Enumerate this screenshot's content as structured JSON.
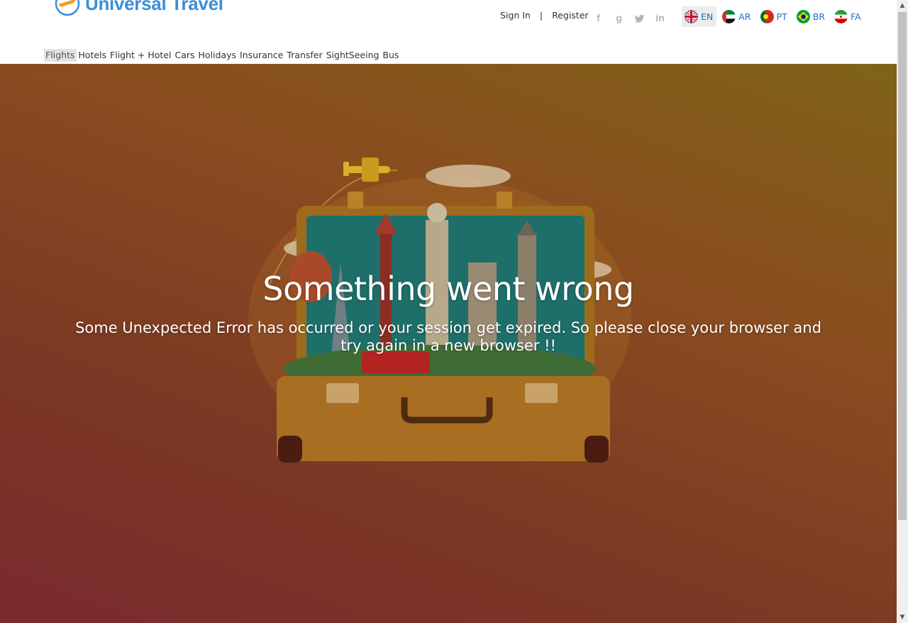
{
  "brand": {
    "name": "Universal Travel"
  },
  "auth": {
    "sign_in": "Sign In",
    "separator": "|",
    "register": "Register"
  },
  "social": [
    {
      "icon": "facebook-icon",
      "glyph": "f"
    },
    {
      "icon": "google-icon",
      "glyph": "g"
    },
    {
      "icon": "twitter-icon",
      "glyph": "t"
    },
    {
      "icon": "linkedin-icon",
      "glyph": "in"
    }
  ],
  "languages": [
    {
      "code": "EN",
      "flag": "uk-flag-icon",
      "active": true
    },
    {
      "code": "AR",
      "flag": "uae-flag-icon",
      "active": false
    },
    {
      "code": "PT",
      "flag": "portugal-flag-icon",
      "active": false
    },
    {
      "code": "BR",
      "flag": "brazil-flag-icon",
      "active": false
    },
    {
      "code": "FA",
      "flag": "iran-flag-icon",
      "active": false
    }
  ],
  "nav": {
    "items": [
      {
        "label": "Flights",
        "active": true
      },
      {
        "label": "Hotels",
        "active": false
      },
      {
        "label": "Flight + Hotel",
        "active": false
      },
      {
        "label": "Cars",
        "active": false
      },
      {
        "label": "Holidays",
        "active": false
      },
      {
        "label": "Insurance",
        "active": false
      },
      {
        "label": "Transfer",
        "active": false
      },
      {
        "label": "SightSeeing",
        "active": false
      },
      {
        "label": "Bus",
        "active": false
      }
    ]
  },
  "error": {
    "title": "Something went wrong",
    "message": "Some Unexpected Error has occurred or your session get expired. So please close your browser and try again in a new browser !!"
  },
  "colors": {
    "brand_blue": "#3b8fd6",
    "link_blue": "#1a73c8",
    "hero_top": "#7f6318",
    "hero_bottom": "#7a2a2e"
  }
}
